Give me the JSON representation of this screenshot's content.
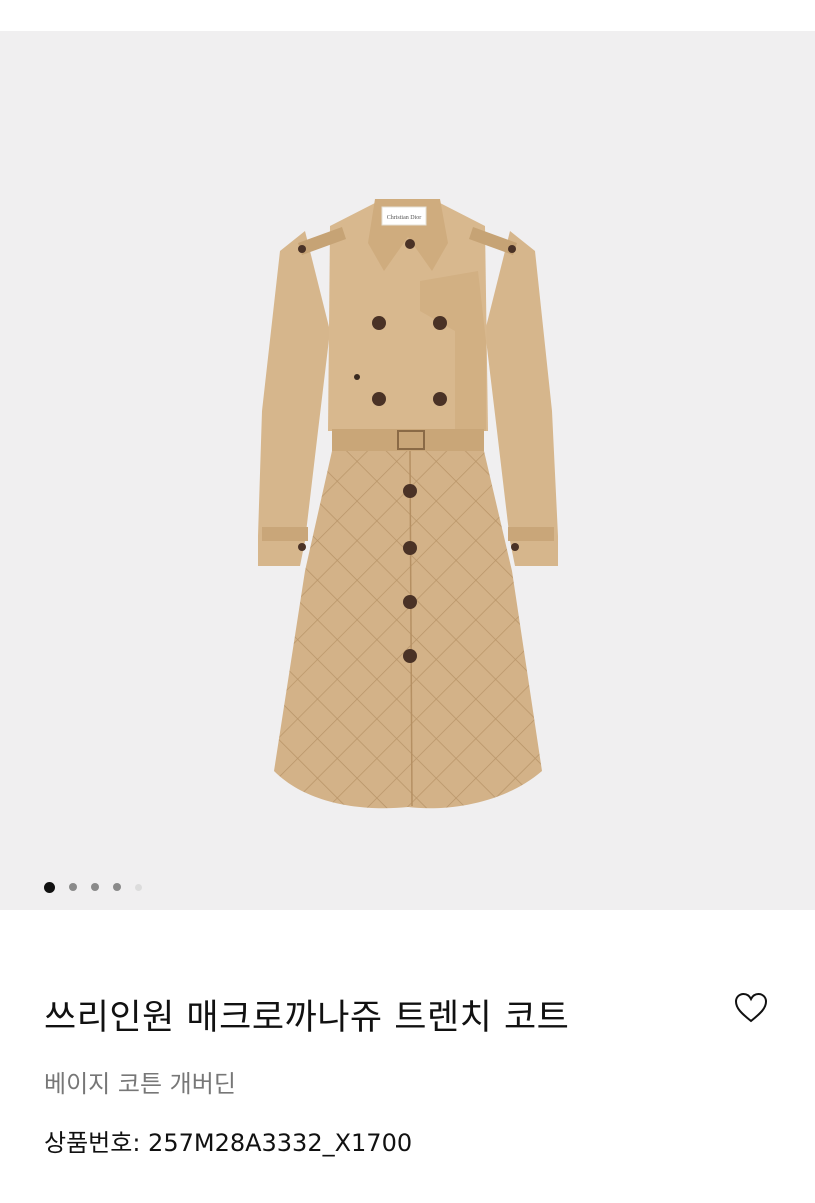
{
  "product": {
    "name": "쓰리인원 매크로까나쥬 트렌치 코트",
    "material": "베이지 코튼 개버딘",
    "code_label": "상품번호:",
    "code_value": "257M28A3332_X1700",
    "image_label": "Christian Dior"
  },
  "gallery": {
    "image_count": 5,
    "active_index": 0
  },
  "icons": {
    "wishlist": "heart-icon"
  },
  "colors": {
    "gallery_bg": "#f0eff0",
    "coat": "#d5b48a",
    "buttons": "#4a3226",
    "active_dot": "#111111"
  }
}
